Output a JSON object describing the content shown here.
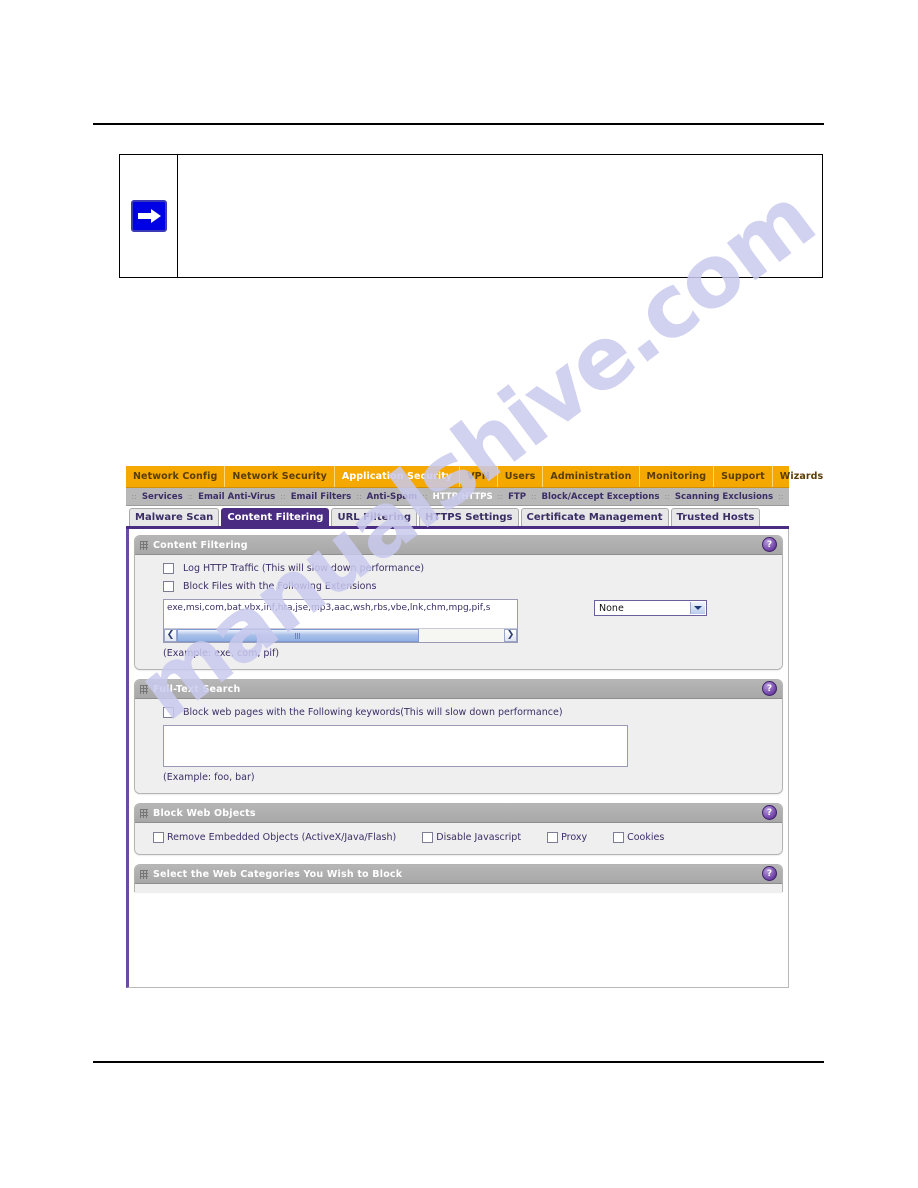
{
  "note": {
    "icon": "blue-arrow-note-icon",
    "text": ""
  },
  "device_ui": {
    "primary_nav": [
      {
        "label": "Network Config",
        "active": false
      },
      {
        "label": "Network Security",
        "active": false
      },
      {
        "label": "Application Security",
        "active": true
      },
      {
        "label": "VPN",
        "active": false
      },
      {
        "label": "Users",
        "active": false
      },
      {
        "label": "Administration",
        "active": false
      },
      {
        "label": "Monitoring",
        "active": false
      },
      {
        "label": "Support",
        "active": false
      },
      {
        "label": "Wizards",
        "active": false
      }
    ],
    "secondary_nav": [
      {
        "label": "Services",
        "active": false
      },
      {
        "label": "Email Anti-Virus",
        "active": false
      },
      {
        "label": "Email Filters",
        "active": false
      },
      {
        "label": "Anti-Spam",
        "active": false
      },
      {
        "label": "HTTP/HTTPS",
        "active": true
      },
      {
        "label": "FTP",
        "active": false
      },
      {
        "label": "Block/Accept Exceptions",
        "active": false
      },
      {
        "label": "Scanning Exclusions",
        "active": false
      }
    ],
    "tabs": [
      {
        "label": "Malware Scan",
        "active": false
      },
      {
        "label": "Content Filtering",
        "active": true
      },
      {
        "label": "URL Filtering",
        "active": false
      },
      {
        "label": "HTTPS Settings",
        "active": false
      },
      {
        "label": "Certificate Management",
        "active": false
      },
      {
        "label": "Trusted Hosts",
        "active": false
      }
    ],
    "sections": {
      "content_filtering": {
        "title": "Content Filtering",
        "help_glyph": "?",
        "log_http_label": "Log HTTP Traffic (This will slow down performance)",
        "log_http_checked": false,
        "block_ext_label": "Block Files with the Following Extensions",
        "block_ext_checked": false,
        "extensions_value": "exe,msi,com,bat,vbx,inf,hta,jse,mp3,aac,wsh,rbs,vbe,lnk,chm,mpg,pif,s",
        "extensions_example": "(Example: exe, com, pif)",
        "dropdown_value": "None",
        "scroll_left_glyph": "❮",
        "scroll_right_glyph": "❯"
      },
      "full_text_search": {
        "title": "Full-Text Search",
        "help_glyph": "?",
        "keyword_label": "Block web pages with the Following keywords(This will slow down performance)",
        "keyword_checked": false,
        "keyword_value": "",
        "keyword_example": "(Example: foo, bar)"
      },
      "block_web_objects": {
        "title": "Block Web Objects",
        "help_glyph": "?",
        "items": [
          {
            "label": "Remove Embedded Objects (ActiveX/Java/Flash)",
            "checked": false
          },
          {
            "label": "Disable Javascript",
            "checked": false
          },
          {
            "label": "Proxy",
            "checked": false
          },
          {
            "label": "Cookies",
            "checked": false
          }
        ]
      },
      "web_categories": {
        "title": "Select the Web Categories You Wish to Block",
        "help_glyph": "?"
      }
    }
  },
  "watermark": {
    "text": "manualshive.com"
  },
  "colors": {
    "nav_orange": "#f5a800",
    "subnav_gray": "#b8b8b8",
    "tab_active_purple": "#4b2c83",
    "section_header_gray": "#a8a8a8",
    "label_purple": "#3b2e66",
    "note_arrow_blue": "#0000e4"
  }
}
